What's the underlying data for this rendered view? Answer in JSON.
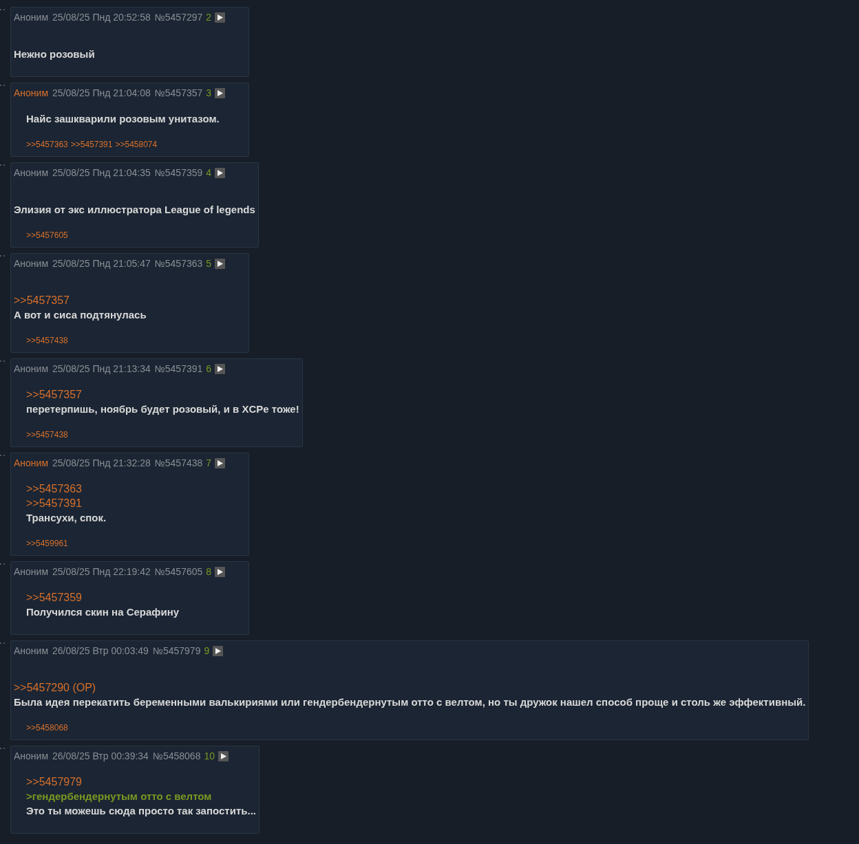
{
  "posts": [
    {
      "author": "Аноним",
      "author_highlighted": false,
      "date": "25/08/25 Пнд 20:52:58",
      "number": "№5457297",
      "ordinal": "2",
      "indented": false,
      "lines": [
        {
          "kind": "text",
          "text": "Нежно розовый"
        }
      ]
    },
    {
      "author": "Аноним",
      "author_highlighted": true,
      "date": "25/08/25 Пнд 21:04:08",
      "number": "№5457357",
      "ordinal": "3",
      "indented": true,
      "lines": [
        {
          "kind": "text",
          "text": "Найс зашкварили розовым унитазом."
        }
      ],
      "replies": [
        ">>5457363",
        ">>5457391",
        ">>5458074"
      ]
    },
    {
      "author": "Аноним",
      "author_highlighted": false,
      "date": "25/08/25 Пнд 21:04:35",
      "number": "№5457359",
      "ordinal": "4",
      "indented": false,
      "lines": [
        {
          "kind": "text",
          "text": "Элизия от экс иллюстратора League of legends"
        }
      ],
      "replies": [
        ">>5457605"
      ]
    },
    {
      "author": "Аноним",
      "author_highlighted": false,
      "date": "25/08/25 Пнд 21:05:47",
      "number": "№5457363",
      "ordinal": "5",
      "indented": false,
      "lines": [
        {
          "kind": "reply_link",
          "text": ">>5457357"
        },
        {
          "kind": "text",
          "text": "А вот и сиса подтянулась"
        }
      ],
      "replies": [
        ">>5457438"
      ]
    },
    {
      "author": "Аноним",
      "author_highlighted": false,
      "date": "25/08/25 Пнд 21:13:34",
      "number": "№5457391",
      "ordinal": "6",
      "indented": true,
      "lines": [
        {
          "kind": "reply_link",
          "text": ">>5457357"
        },
        {
          "kind": "text",
          "text": "перетерпишь, ноябрь будет розовый, и в XCPе тоже!"
        }
      ],
      "replies": [
        ">>5457438"
      ]
    },
    {
      "author": "Аноним",
      "author_highlighted": true,
      "date": "25/08/25 Пнд 21:32:28",
      "number": "№5457438",
      "ordinal": "7",
      "indented": true,
      "lines": [
        {
          "kind": "reply_link",
          "text": ">>5457363"
        },
        {
          "kind": "reply_link",
          "text": ">>5457391"
        },
        {
          "kind": "text",
          "text": "Трансухи, спок."
        }
      ],
      "replies": [
        ">>5459961"
      ]
    },
    {
      "author": "Аноним",
      "author_highlighted": false,
      "date": "25/08/25 Пнд 22:19:42",
      "number": "№5457605",
      "ordinal": "8",
      "indented": true,
      "lines": [
        {
          "kind": "reply_link",
          "text": ">>5457359"
        },
        {
          "kind": "text",
          "text": "Получился скин на Серафину"
        }
      ]
    },
    {
      "author": "Аноним",
      "author_highlighted": false,
      "date": "26/08/25 Втр 00:03:49",
      "number": "№5457979",
      "ordinal": "9",
      "indented": false,
      "lines": [
        {
          "kind": "reply_link",
          "text": ">>5457290 (OP)"
        },
        {
          "kind": "text",
          "text": "Была идея перекатить беременными валькириями или гендербендернутым отто с велтом, но ты дружок нашел способ проще и столь же эффективный."
        }
      ],
      "replies": [
        ">>5458068"
      ]
    },
    {
      "author": "Аноним",
      "author_highlighted": false,
      "date": "26/08/25 Втр 00:39:34",
      "number": "№5458068",
      "ordinal": "10",
      "indented": true,
      "lines": [
        {
          "kind": "reply_link",
          "text": ">>5457979"
        },
        {
          "kind": "quote",
          "text": ">гендербендернутым отто с велтом"
        },
        {
          "kind": "text",
          "text": "Это ты можешь сюда просто так запостить..."
        }
      ]
    }
  ]
}
